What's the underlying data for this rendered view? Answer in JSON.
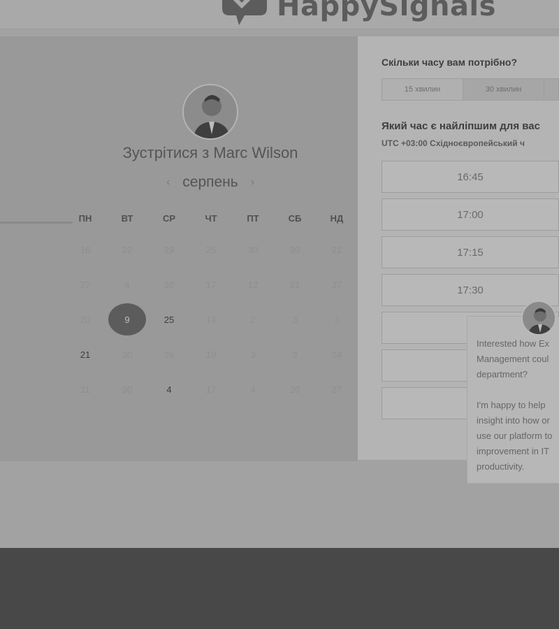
{
  "header": {
    "logo_text": "HappySignals"
  },
  "booking": {
    "title": "Зустрітися з Marc Wilson",
    "month": "серпень",
    "weekdays": [
      "ПН",
      "ВТ",
      "СР",
      "ЧТ",
      "ПТ",
      "СБ",
      "НД"
    ],
    "days": [
      [
        "16",
        "22",
        "29",
        "25",
        "30",
        "30",
        "21"
      ],
      [
        "27",
        "4",
        "30",
        "17",
        "12",
        "21",
        "27"
      ],
      [
        "20",
        "9",
        "25",
        "14",
        "2",
        "3",
        "3"
      ],
      [
        "21",
        "30",
        "26",
        "19",
        "3",
        "3",
        "24"
      ],
      [
        "11",
        "30",
        "4",
        "17",
        "4",
        "20",
        "27"
      ]
    ],
    "selected_day": "9"
  },
  "scheduler": {
    "duration_question": "Скільки часу вам потрібно?",
    "durations": [
      "15 хвилин",
      "30 хвилин"
    ],
    "time_question": "Який час є найліпшим для вас",
    "timezone": "UTC +03:00 Східноєвропейський ч",
    "slots": [
      "16:45",
      "17:00",
      "17:15",
      "17:30",
      "",
      "",
      ""
    ]
  },
  "chat": {
    "paragraph1": [
      "Interested how Ex",
      "Management coul",
      "department?"
    ],
    "paragraph2": [
      "I'm happy to help",
      "insight into how or",
      "use our platform to",
      "improvement in IT",
      "productivity."
    ]
  },
  "colors": {
    "selected_day": "#5c5c5c",
    "footer": "#484848"
  }
}
